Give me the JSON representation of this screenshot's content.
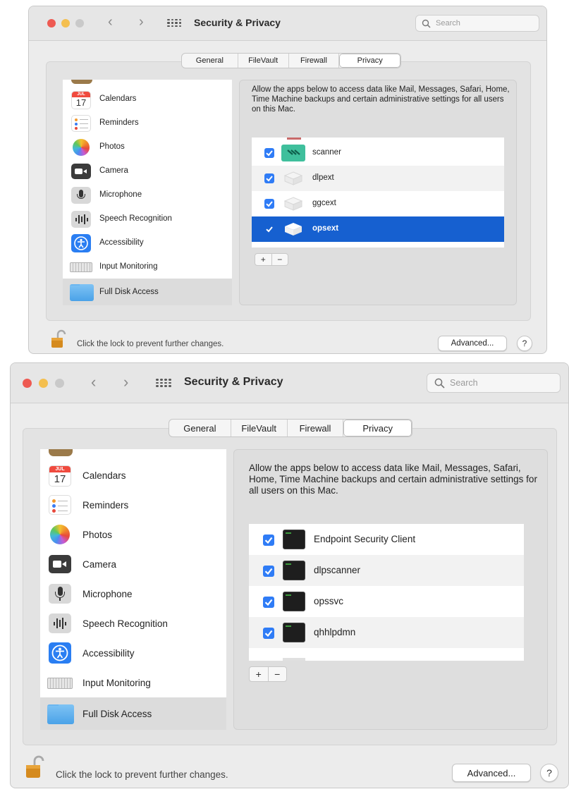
{
  "colors": {
    "close": "#ee5a52",
    "minimize": "#f4bf4f",
    "zoom_inactive": "#c9c9c9",
    "selection": "#1660d0",
    "checkbox": "#2f7cf6"
  },
  "windows": [
    {
      "title": "Security & Privacy",
      "search_placeholder": "Search",
      "tabs": [
        "General",
        "FileVault",
        "Firewall",
        "Privacy"
      ],
      "active_tab": "Privacy",
      "sidebar": [
        {
          "label": "Calendars",
          "icon": "calendar-icon",
          "date_month": "JUL",
          "date_day": "17"
        },
        {
          "label": "Reminders",
          "icon": "reminders-icon"
        },
        {
          "label": "Photos",
          "icon": "photos-icon"
        },
        {
          "label": "Camera",
          "icon": "camera-icon"
        },
        {
          "label": "Microphone",
          "icon": "microphone-icon"
        },
        {
          "label": "Speech Recognition",
          "icon": "speech-recognition-icon"
        },
        {
          "label": "Accessibility",
          "icon": "accessibility-icon"
        },
        {
          "label": "Input Monitoring",
          "icon": "keyboard-icon"
        },
        {
          "label": "Full Disk Access",
          "icon": "folder-icon",
          "selected": true
        }
      ],
      "description": "Allow the apps below to access data like Mail, Messages, Safari, Home, Time Machine backups and certain administrative settings for all users on this Mac.",
      "apps": [
        {
          "name": "scanner",
          "checked": true,
          "icon": "scanner-app-icon"
        },
        {
          "name": "dlpext",
          "checked": true,
          "icon": "extension-icon"
        },
        {
          "name": "ggcext",
          "checked": true,
          "icon": "extension-icon"
        },
        {
          "name": "opsext",
          "checked": true,
          "icon": "extension-icon",
          "selected": true
        }
      ],
      "add_label": "+",
      "remove_label": "−",
      "lock_text": "Click the lock to prevent further changes.",
      "advanced_label": "Advanced...",
      "help_label": "?"
    },
    {
      "title": "Security & Privacy",
      "search_placeholder": "Search",
      "tabs": [
        "General",
        "FileVault",
        "Firewall",
        "Privacy"
      ],
      "active_tab": "Privacy",
      "sidebar": [
        {
          "label": "Calendars",
          "icon": "calendar-icon",
          "date_month": "JUL",
          "date_day": "17"
        },
        {
          "label": "Reminders",
          "icon": "reminders-icon"
        },
        {
          "label": "Photos",
          "icon": "photos-icon"
        },
        {
          "label": "Camera",
          "icon": "camera-icon"
        },
        {
          "label": "Microphone",
          "icon": "microphone-icon"
        },
        {
          "label": "Speech Recognition",
          "icon": "speech-recognition-icon"
        },
        {
          "label": "Accessibility",
          "icon": "accessibility-icon"
        },
        {
          "label": "Input Monitoring",
          "icon": "keyboard-icon"
        },
        {
          "label": "Full Disk Access",
          "icon": "folder-icon",
          "selected": true
        }
      ],
      "description": "Allow the apps below to access data like Mail, Messages, Safari, Home, Time Machine backups and certain administrative settings for all users on this Mac.",
      "apps": [
        {
          "name": "Endpoint Security Client",
          "checked": true,
          "icon": "terminal-app-icon"
        },
        {
          "name": "dlpscanner",
          "checked": true,
          "icon": "terminal-app-icon"
        },
        {
          "name": "opssvc",
          "checked": true,
          "icon": "terminal-app-icon"
        },
        {
          "name": "qhhlpdmn",
          "checked": true,
          "icon": "terminal-app-icon"
        }
      ],
      "add_label": "+",
      "remove_label": "−",
      "lock_text": "Click the lock to prevent further changes.",
      "advanced_label": "Advanced...",
      "help_label": "?"
    }
  ]
}
